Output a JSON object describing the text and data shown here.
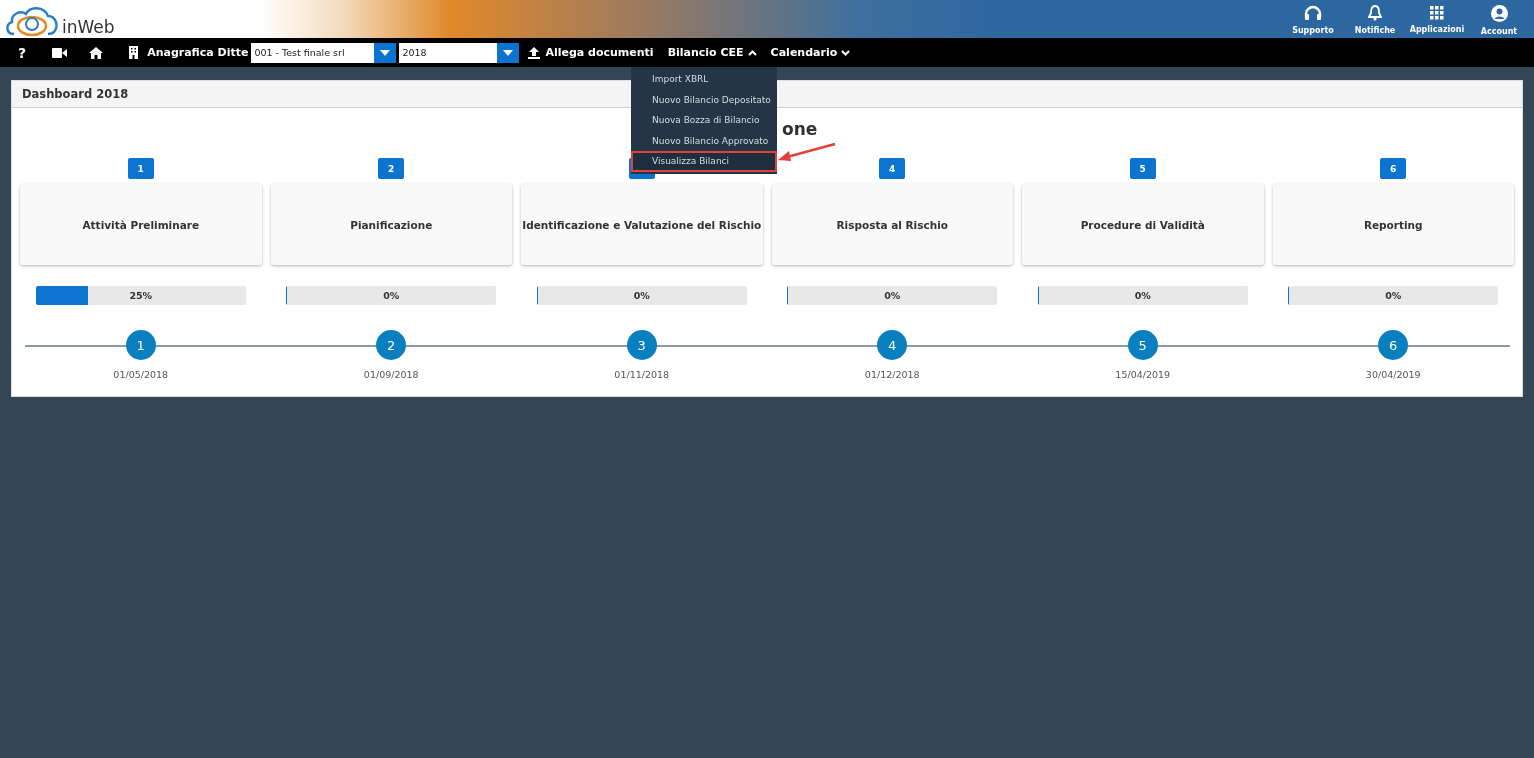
{
  "header": {
    "logo_text": "inWeb",
    "actions": [
      {
        "kind": "support",
        "label": "Supporto"
      },
      {
        "kind": "bell",
        "label": "Notifiche"
      },
      {
        "kind": "grid",
        "label": "Applicazioni"
      },
      {
        "kind": "account",
        "label": "Account"
      }
    ]
  },
  "navbar": {
    "help": "?",
    "company_label": "Anagrafica Ditte",
    "company": "001 - Test finale srl",
    "year": "2018",
    "attach": "Allega documenti",
    "menus": [
      {
        "label": "Bilancio CEE",
        "expanded": true
      },
      {
        "label": "Calendario",
        "expanded": false
      }
    ]
  },
  "dropdown": {
    "items": [
      {
        "label": "Import XBRL",
        "highlighted": false
      },
      {
        "label": "Nuovo Bilancio Depositato",
        "highlighted": false
      },
      {
        "label": "Nuova Bozza di Bilancio",
        "highlighted": false
      },
      {
        "label": "Nuovo Bilancio Approvato",
        "highlighted": false
      },
      {
        "label": "Visualizza Bilanci",
        "highlighted": true
      }
    ]
  },
  "panel": {
    "title": "Dashboard 2018",
    "heading": "one",
    "phases": [
      {
        "badge": "1",
        "name": "Attività Preliminare",
        "level": 0.25,
        "percent": "25%",
        "step": "1",
        "date": "01/05/2018"
      },
      {
        "badge": "2",
        "name": "Pianificazione",
        "level": 0,
        "percent": "0%",
        "step": "2",
        "date": "01/09/2018"
      },
      {
        "name": "Identificazione e Valutazione del Rischio",
        "level": 0,
        "percent": "0%",
        "step": "3",
        "date": "01/11/2018"
      },
      {
        "badge": "4",
        "name": "Risposta al Rischio",
        "level": 0,
        "percent": "0%",
        "step": "4",
        "date": "01/12/2018"
      },
      {
        "badge": "5",
        "name": "Procedure di Validità",
        "level": 0,
        "percent": "0%",
        "step": "5",
        "date": "15/04/2019"
      },
      {
        "badge": "6",
        "name": "Reporting",
        "level": 0,
        "percent": "0%",
        "step": "6",
        "date": "30/04/2019"
      }
    ]
  }
}
